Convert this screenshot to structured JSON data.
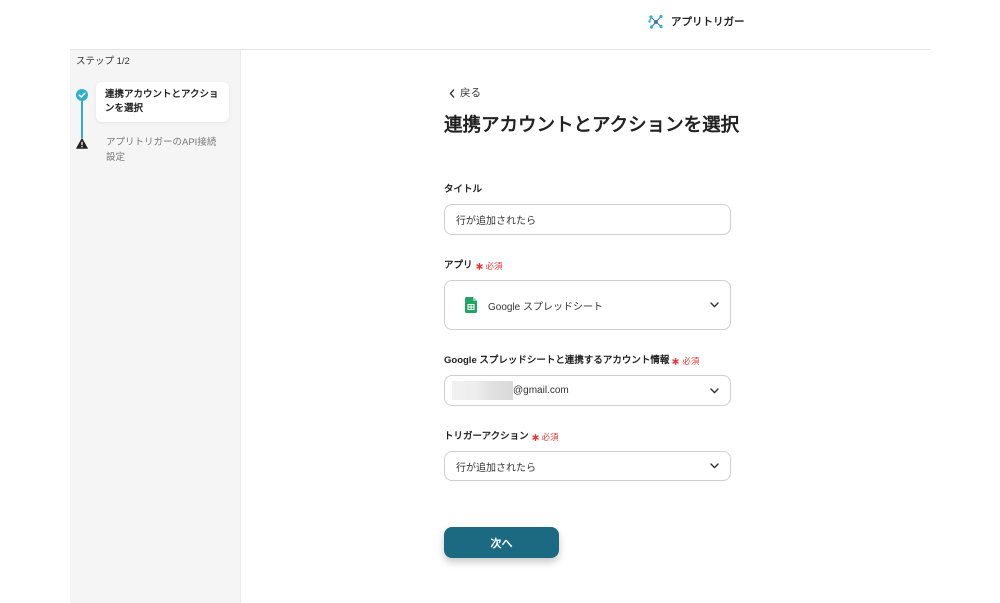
{
  "header": {
    "logo_icon": "app-trigger-logo-icon",
    "app_name": "アプリトリガー"
  },
  "sidebar": {
    "step_counter": "ステップ 1/2",
    "steps": [
      {
        "icon": "check-circle-icon",
        "label": "連携アカウントとアクションを選択"
      },
      {
        "icon": "warning-icon",
        "label": "アプリトリガーのAPI接続設定"
      }
    ]
  },
  "main": {
    "back_icon": "chevron-left-icon",
    "back_label": "戻る",
    "title": "連携アカウントとアクションを選択",
    "form": {
      "dropdown_icon": "chevron-down-icon",
      "title_field": {
        "label": "タイトル",
        "value": "行が追加されたら"
      },
      "app_field": {
        "label": "アプリ",
        "required_label": "必須",
        "icon": "google-sheets-icon",
        "value": "Google スプレッドシート"
      },
      "account_field": {
        "label": "Google スプレッドシートと連携するアカウント情報",
        "required_label": "必須",
        "value": "@gmail.com"
      },
      "trigger_action_field": {
        "label": "トリガーアクション",
        "required_label": "必須",
        "value": "行が追加されたら"
      }
    },
    "next_button_label": "次へ"
  },
  "colors": {
    "accent": "#30b0cc",
    "primary_button": "#1c6982",
    "required": "#e53935",
    "sidebar_background": "#f5f5f5",
    "sheets_green": "#21a464"
  }
}
